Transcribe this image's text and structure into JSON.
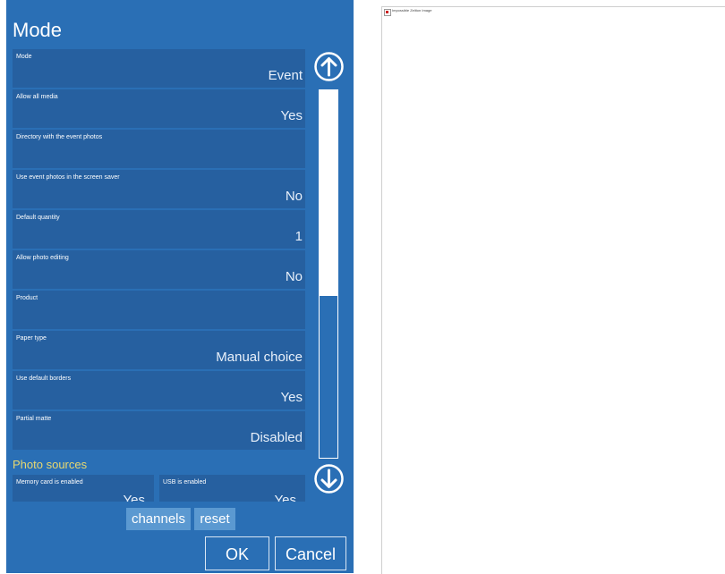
{
  "title": "Mode",
  "settings": [
    {
      "label": "Mode",
      "value": "Event"
    },
    {
      "label": "Allow all media",
      "value": "Yes"
    },
    {
      "label": "Directory with the event photos",
      "value": ""
    },
    {
      "label": "Use event photos in the screen saver",
      "value": "No"
    },
    {
      "label": "Default quantity",
      "value": "1"
    },
    {
      "label": "Allow photo editing",
      "value": "No"
    },
    {
      "label": "Product",
      "value": ""
    },
    {
      "label": "Paper type",
      "value": "Manual choice"
    },
    {
      "label": "Use default borders",
      "value": "Yes"
    },
    {
      "label": "Partial matte",
      "value": "Disabled"
    }
  ],
  "section_photo_sources": "Photo sources",
  "photo_sources": [
    {
      "label": "Memory card is enabled",
      "value": "Yes"
    },
    {
      "label": "USB is enabled",
      "value": "Yes"
    }
  ],
  "buttons": {
    "channels": "channels",
    "reset": "reset",
    "ok": "OK",
    "cancel": "Cancel"
  },
  "scrollbar": {
    "thumb_fraction": 0.56,
    "position": 0
  },
  "icons": {
    "scroll_up": "arrow-up-circle-icon",
    "scroll_down": "arrow-down-circle-icon",
    "broken_image": "broken-image-icon"
  },
  "right_panel": {
    "image_alt": "Impossible Zeliton Image"
  },
  "colors": {
    "panel": "#2a6fb5",
    "field": "#2660a0",
    "section": "#e8d870",
    "button": "#5b99d1"
  }
}
